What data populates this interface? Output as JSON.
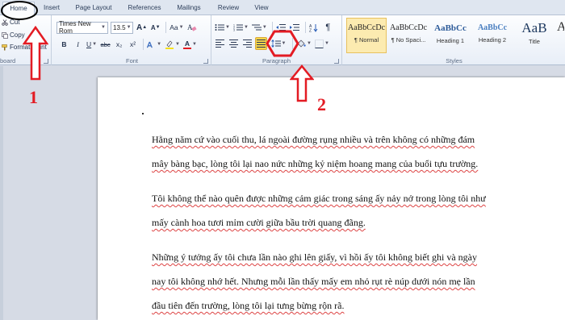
{
  "tabs": [
    {
      "label": "Home",
      "active": true
    },
    {
      "label": "Insert"
    },
    {
      "label": "Page Layout"
    },
    {
      "label": "References"
    },
    {
      "label": "Mailings"
    },
    {
      "label": "Review"
    },
    {
      "label": "View"
    }
  ],
  "clipboard": {
    "cut": "Cut",
    "copy": "Copy",
    "format_painter": "Format Paint",
    "group_label": "board"
  },
  "font": {
    "font_name": "Times New Rom",
    "font_size": "13.5",
    "grow": "A",
    "shrink": "A",
    "change_case": "Aa",
    "bold": "B",
    "italic": "I",
    "underline": "U",
    "strike": "abc",
    "subscript": "x₂",
    "superscript": "x²",
    "font_color": "A",
    "highlight_color": "#f7e11b",
    "font_color_value": "#e31b23",
    "group_label": "Font"
  },
  "paragraph": {
    "group_label": "Paragraph",
    "show_marks": "¶"
  },
  "styles": {
    "items": [
      {
        "sample": "AaBbCcDc",
        "name": "¶ Normal",
        "selected": true
      },
      {
        "sample": "AaBbCcDc",
        "name": "¶ No Spaci..."
      },
      {
        "sample": "AaBbCc",
        "name": "Heading 1"
      },
      {
        "sample": "AaBbCc",
        "name": "Heading 2"
      },
      {
        "sample": "AaB",
        "name": "Title"
      },
      {
        "sample": "A",
        "name": ""
      }
    ],
    "group_label": "Styles"
  },
  "document": {
    "paragraphs": [
      {
        "lines": [
          "Hằng năm cứ vào cuối thu, lá ngoài đường rụng nhiều và trên không có những đám",
          "mây bàng bạc, lòng tôi lại nao nức những kỷ niệm hoang mang của buổi tựu trường."
        ]
      },
      {
        "lines": [
          "Tôi không thể nào quên được những cảm giác trong sáng ấy nảy nở trong lòng tôi như",
          "mấy cành hoa tươi mỉm cười giữa bầu trời quang đãng."
        ]
      },
      {
        "lines": [
          "Những ý tưởng ấy tôi chưa lần nào ghi lên giấy, vì hồi ấy tôi không biết ghi và ngày",
          "nay tôi không nhớ hết. Nhưng mỗi lần thấy mấy em nhỏ rụt rè núp dưới nón mẹ lần",
          "đầu tiên đến trường, lòng tôi lại tưng bừng rộn rã."
        ]
      }
    ]
  },
  "annotations": {
    "step1": "1",
    "step2": "2",
    "color": "#e31b23"
  }
}
